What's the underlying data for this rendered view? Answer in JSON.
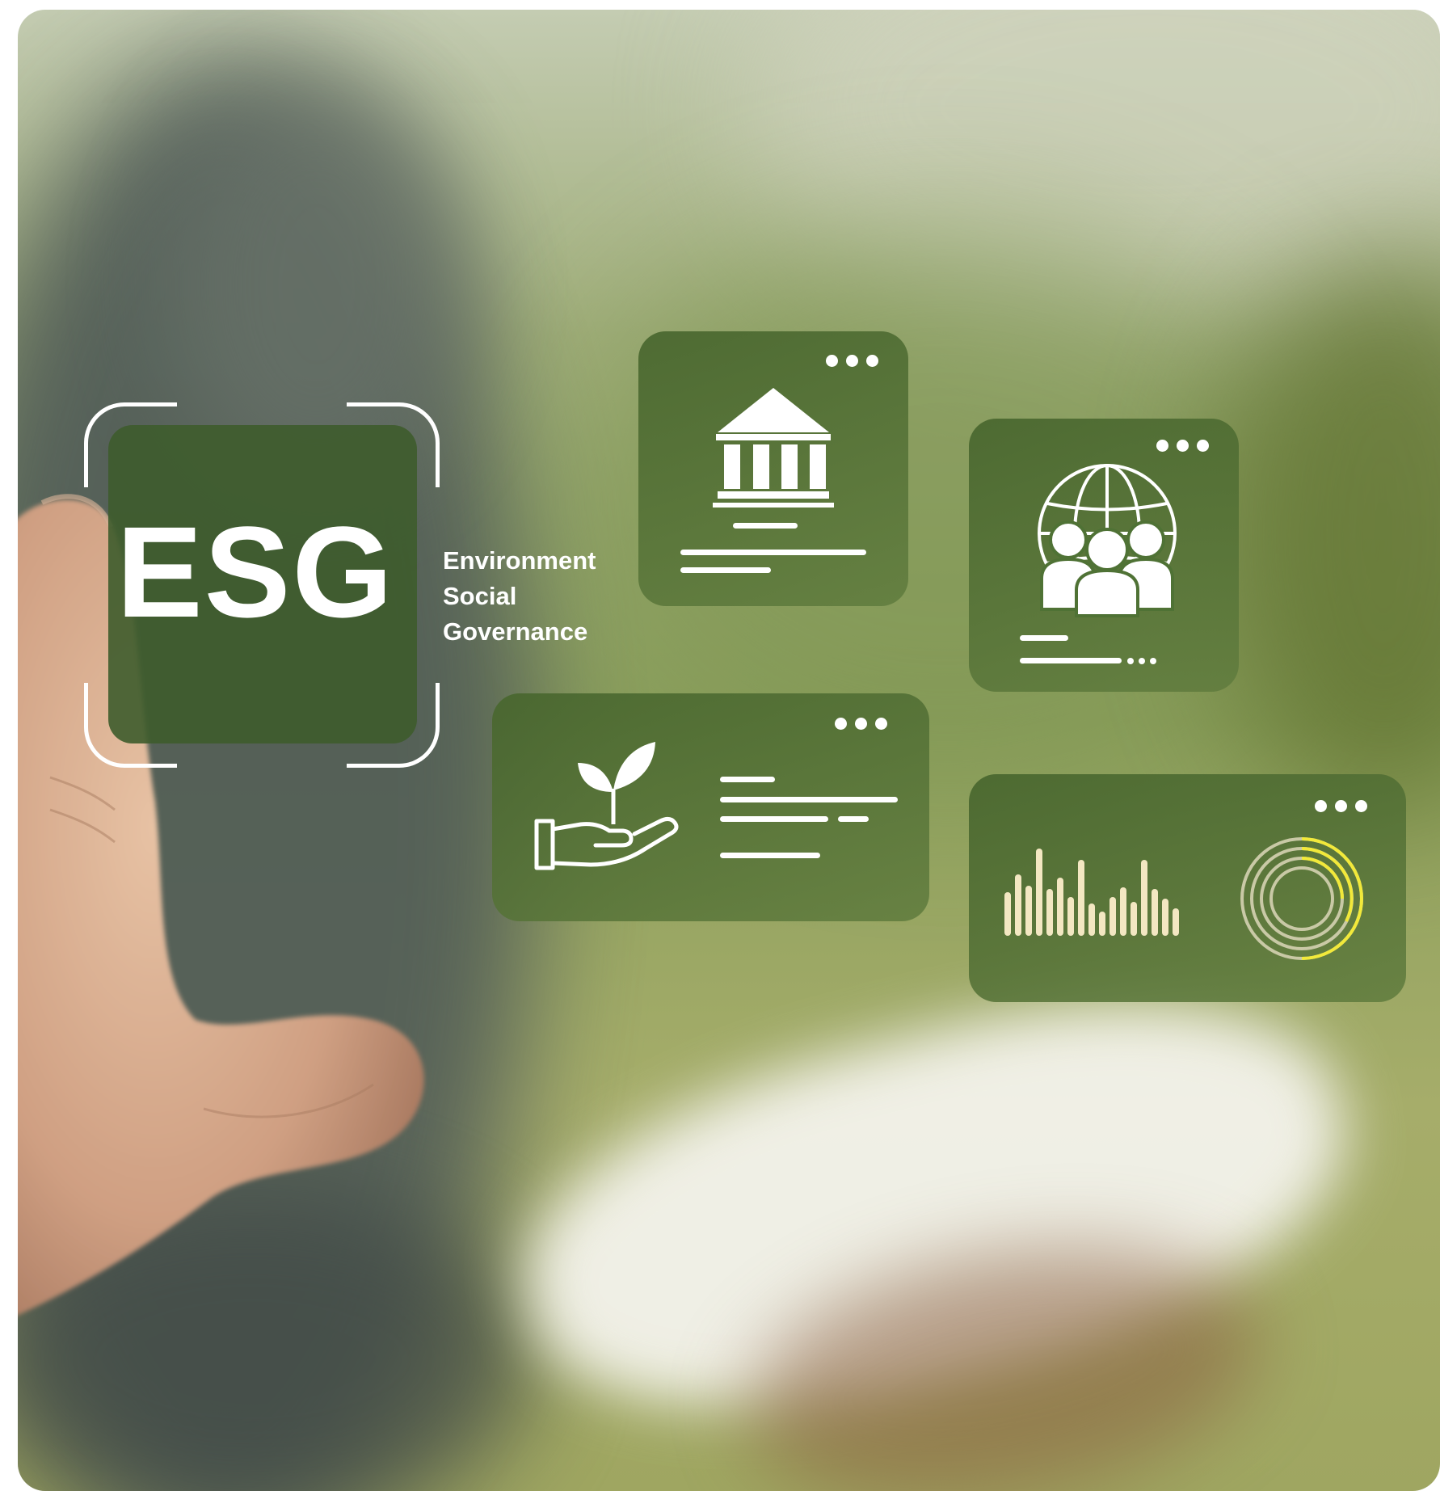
{
  "esg": {
    "title": "ESG",
    "subtitle": [
      "Environment",
      "Social",
      "Governance"
    ]
  },
  "cards": [
    {
      "name": "governance-card",
      "icon": "bank-building-icon"
    },
    {
      "name": "social-card",
      "icon": "globe-people-icon"
    },
    {
      "name": "environment-card",
      "icon": "hand-plant-icon"
    },
    {
      "name": "analytics-card",
      "icon": "bar-chart-donut-icon"
    }
  ],
  "colors": {
    "card_green": "#4f7235",
    "donut_accent": "#f2e93a",
    "bar_color": "#f3e7c2"
  }
}
